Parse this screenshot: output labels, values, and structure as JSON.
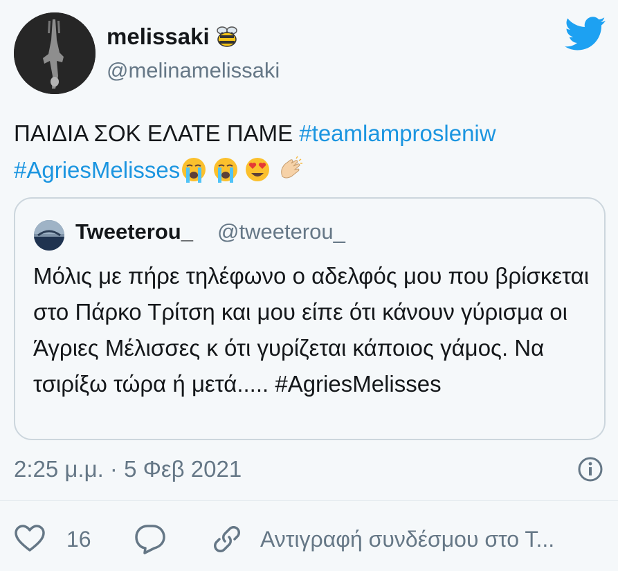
{
  "author": {
    "display_name": "melissaki",
    "name_emoji": "bee-emoji",
    "handle": "@melinamelissaki"
  },
  "tweet": {
    "text_plain": "ΠΑΙΔΙΑ ΣΟΚ ΕΛΑΤΕ ΠΑΜΕ ",
    "hashtag_1": "#teamlamprosleniw",
    "hashtag_2": "#AgriesMelisses",
    "emojis": [
      "loudly-crying-face-emoji",
      "loudly-crying-face-emoji",
      "heart-eyes-emoji",
      "clapping-hands-emoji"
    ]
  },
  "quoted_tweet": {
    "display_name": "Tweeterou_",
    "handle": "@tweeterou_",
    "text": "Μόλις με πήρε τηλέφωνο ο αδελφός μου που βρίσκεται στο Πάρκο Τρίτση και μου είπε ότι κάνουν γύρισμα οι Άγριες Μέλισσες κ ότι γυρίζεται κάποιος γάμος. Να τσιρίξω τώρα ή μετά..... #AgriesMelisses"
  },
  "meta": {
    "timestamp": "2:25 μ.μ. · 5 Φεβ 2021"
  },
  "actions": {
    "like_count": "16",
    "copy_link_label": "Αντιγραφή συνδέσμου στο Τ..."
  },
  "colors": {
    "background": "#f5f8fa",
    "text": "#14171a",
    "muted": "#657786",
    "link": "#1b95e0",
    "border": "#ccd6dd",
    "twitter_blue": "#1da1f2"
  },
  "icons": [
    "twitter-bird-icon",
    "info-icon",
    "heart-icon",
    "reply-icon",
    "link-icon"
  ]
}
